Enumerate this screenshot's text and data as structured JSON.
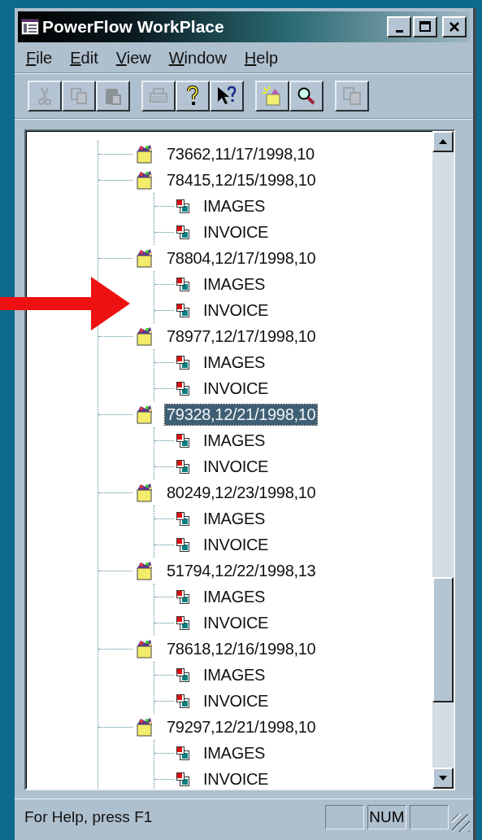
{
  "window": {
    "title": "PowerFlow WorkPlace"
  },
  "menu": [
    {
      "label": "File"
    },
    {
      "label": "Edit"
    },
    {
      "label": "View"
    },
    {
      "label": "Window"
    },
    {
      "label": "Help"
    }
  ],
  "toolbar": [
    [
      {
        "kind": "cut",
        "disabled": true
      },
      {
        "kind": "copy",
        "disabled": true
      },
      {
        "kind": "paste",
        "disabled": true
      }
    ],
    [
      {
        "kind": "print",
        "disabled": true
      },
      {
        "kind": "help",
        "disabled": false
      },
      {
        "kind": "context-help",
        "disabled": false
      }
    ],
    [
      {
        "kind": "new",
        "disabled": false
      },
      {
        "kind": "find",
        "disabled": false
      }
    ],
    [
      {
        "kind": "windows",
        "disabled": true
      }
    ]
  ],
  "tree": {
    "nodes": [
      {
        "label": "73662,11/17/1998,10",
        "selected": false
      },
      {
        "label": "78415,12/15/1998,10",
        "selected": false,
        "children": [
          {
            "label": "IMAGES"
          },
          {
            "label": "INVOICE"
          }
        ]
      },
      {
        "label": "78804,12/17/1998,10",
        "selected": false,
        "children": [
          {
            "label": "IMAGES"
          },
          {
            "label": "INVOICE"
          }
        ]
      },
      {
        "label": "78977,12/17/1998,10",
        "selected": false,
        "children": [
          {
            "label": "IMAGES"
          },
          {
            "label": "INVOICE"
          }
        ]
      },
      {
        "label": "79328,12/21/1998,10",
        "selected": true,
        "children": [
          {
            "label": "IMAGES"
          },
          {
            "label": "INVOICE"
          }
        ]
      },
      {
        "label": "80249,12/23/1998,10",
        "selected": false,
        "children": [
          {
            "label": "IMAGES"
          },
          {
            "label": "INVOICE"
          }
        ]
      },
      {
        "label": "51794,12/22/1998,13",
        "selected": false,
        "children": [
          {
            "label": "IMAGES"
          },
          {
            "label": "INVOICE"
          }
        ]
      },
      {
        "label": "78618,12/16/1998,10",
        "selected": false,
        "children": [
          {
            "label": "IMAGES"
          },
          {
            "label": "INVOICE"
          }
        ]
      },
      {
        "label": "79297,12/21/1998,10",
        "selected": false,
        "children": [
          {
            "label": "IMAGES"
          },
          {
            "label": "INVOICE"
          }
        ]
      }
    ]
  },
  "status_bar": {
    "text": "For Help, press F1",
    "indicators": [
      {
        "label": "NUM"
      }
    ]
  }
}
